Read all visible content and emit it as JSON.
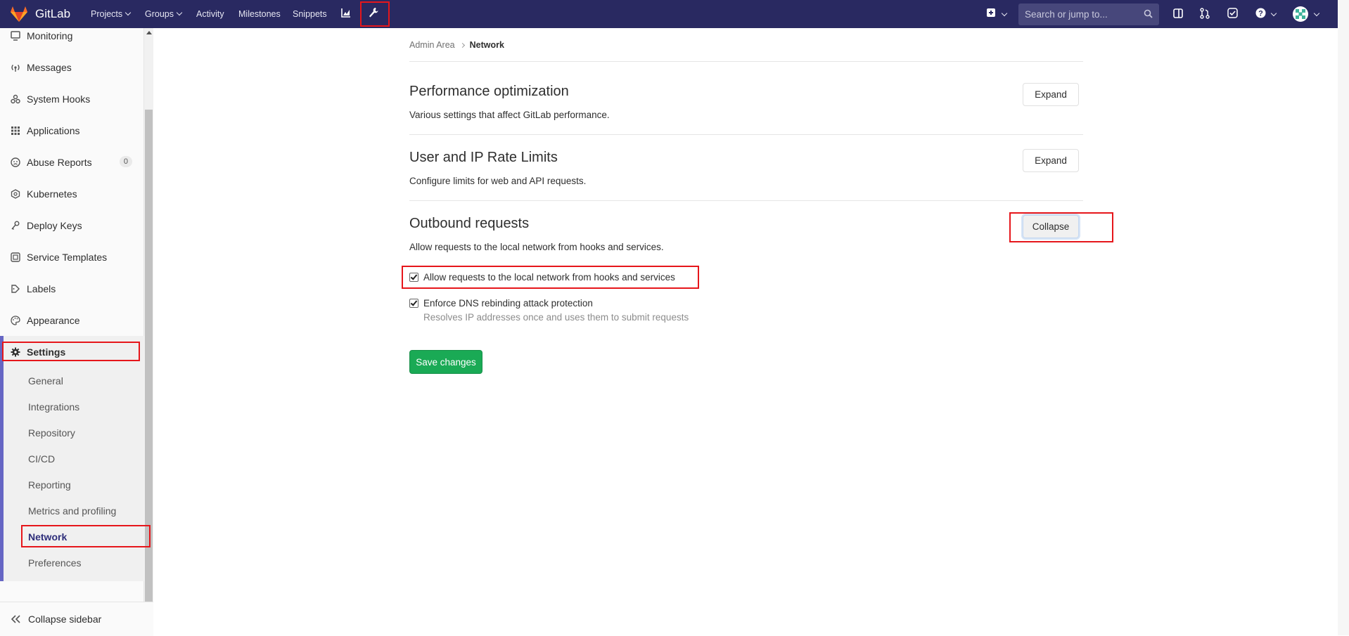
{
  "navbar": {
    "brand": "GitLab",
    "items": [
      "Projects",
      "Groups",
      "Activity",
      "Milestones",
      "Snippets"
    ],
    "search_placeholder": "Search or jump to..."
  },
  "sidebar": {
    "items": [
      {
        "label": "Monitoring",
        "icon": "monitor-icon"
      },
      {
        "label": "Messages",
        "icon": "broadcast-icon"
      },
      {
        "label": "System Hooks",
        "icon": "hook-icon"
      },
      {
        "label": "Applications",
        "icon": "grid-icon"
      },
      {
        "label": "Abuse Reports",
        "icon": "face-icon",
        "badge": "0"
      },
      {
        "label": "Kubernetes",
        "icon": "kubernetes-icon"
      },
      {
        "label": "Deploy Keys",
        "icon": "key-icon"
      },
      {
        "label": "Service Templates",
        "icon": "template-icon"
      },
      {
        "label": "Labels",
        "icon": "labels-icon"
      },
      {
        "label": "Appearance",
        "icon": "palette-icon"
      }
    ],
    "settings_label": "Settings",
    "settings_sub": [
      "General",
      "Integrations",
      "Repository",
      "CI/CD",
      "Reporting",
      "Metrics and profiling",
      "Network",
      "Preferences"
    ],
    "collapse_label": "Collapse sidebar"
  },
  "breadcrumb": {
    "parent": "Admin Area",
    "current": "Network"
  },
  "sections": [
    {
      "title": "Performance optimization",
      "description": "Various settings that affect GitLab performance.",
      "button": "Expand"
    },
    {
      "title": "User and IP Rate Limits",
      "description": "Configure limits for web and API requests.",
      "button": "Expand"
    },
    {
      "title": "Outbound requests",
      "description": "Allow requests to the local network from hooks and services.",
      "button": "Collapse"
    }
  ],
  "outbound": {
    "allow_local_label": "Allow requests to the local network from hooks and services",
    "allow_local_checked": true,
    "dns_label": "Enforce DNS rebinding attack protection",
    "dns_checked": true,
    "dns_help": "Resolves IP addresses once and uses them to submit requests"
  },
  "save_label": "Save changes",
  "colors": {
    "navbar": "#292961",
    "accent": "#6666c4",
    "success": "#1aaa55",
    "highlight": "#e6161b"
  }
}
